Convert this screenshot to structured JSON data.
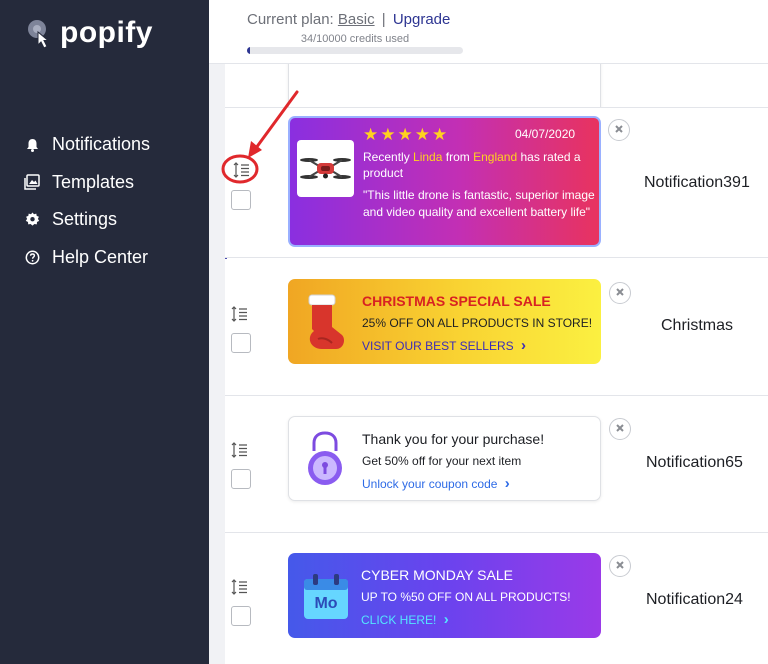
{
  "brand": {
    "name": "popify"
  },
  "sidebar": {
    "items": [
      {
        "label": "Notifications",
        "icon": "bell-icon"
      },
      {
        "label": "Templates",
        "icon": "image-gallery-icon"
      },
      {
        "label": "Settings",
        "icon": "gear-icon"
      },
      {
        "label": "Help Center",
        "icon": "question-circle-icon"
      }
    ]
  },
  "plan": {
    "prefix": "Current plan:",
    "name": "Basic",
    "separator": "|",
    "upgrade_label": "Upgrade",
    "credits_text": "34/10000 credits used",
    "credits_used": 34,
    "credits_total": 10000
  },
  "notifications": [
    {
      "name": "Notification391",
      "stars": "★★★★★",
      "date": "04/07/2020",
      "title_prefix": "Recently",
      "person": "Linda",
      "from_word": "from",
      "place": "England",
      "title_suffix": "has rated a product",
      "quote": "\"This little drone is fantastic, superior image and video quality and excellent battery life\""
    },
    {
      "name": "Christmas",
      "title": "CHRISTMAS SPECIAL SALE",
      "subtitle": "25% OFF ON ALL PRODUCTS IN STORE!",
      "link": "VISIT OUR BEST SELLERS",
      "link_arrow": "›"
    },
    {
      "name": "Notification65",
      "title": "Thank you for your purchase!",
      "subtitle": "Get 50% off for your next item",
      "link": "Unlock your coupon code",
      "link_arrow": "›"
    },
    {
      "name": "Notification24",
      "title": "CYBER MONDAY SALE",
      "subtitle": "UP TO %50 OFF ON ALL PRODUCTS!",
      "link": "CLICK HERE!",
      "link_arrow": "›",
      "badge": "Mo"
    }
  ],
  "colors": {
    "sidebar_bg": "#252a3b",
    "accent": "#2d3592",
    "annotation_red": "#e0282c"
  }
}
